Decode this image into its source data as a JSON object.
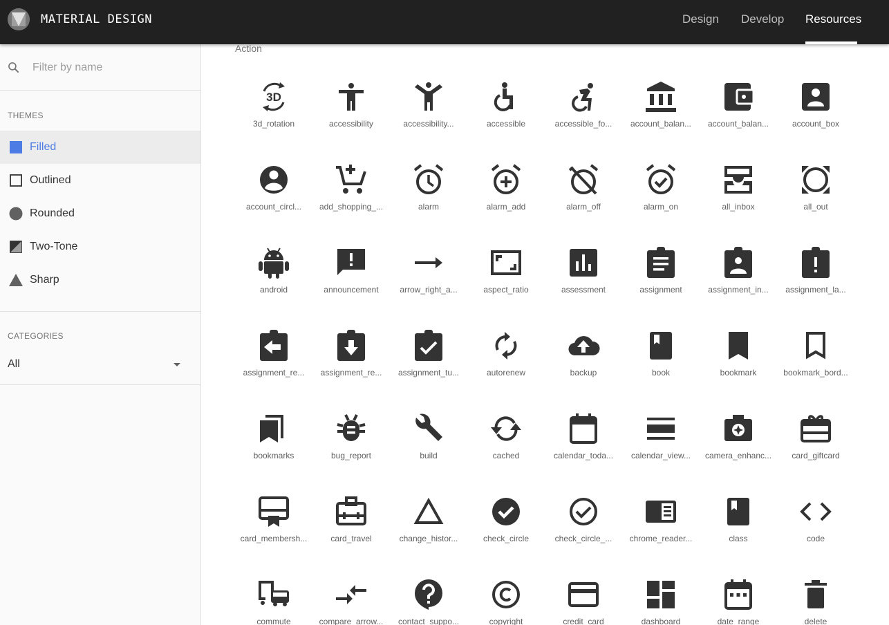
{
  "brand": "MATERIAL DESIGN",
  "nav": [
    {
      "label": "Design",
      "active": false
    },
    {
      "label": "Develop",
      "active": false
    },
    {
      "label": "Resources",
      "active": true
    }
  ],
  "search": {
    "placeholder": "Filter by name",
    "value": ""
  },
  "themes": {
    "title": "THEMES",
    "items": [
      {
        "label": "Filled",
        "icon": "filled-square-icon",
        "active": true
      },
      {
        "label": "Outlined",
        "icon": "outlined-square-icon",
        "active": false
      },
      {
        "label": "Rounded",
        "icon": "rounded-circle-icon",
        "active": false
      },
      {
        "label": "Two-Tone",
        "icon": "two-tone-icon",
        "active": false
      },
      {
        "label": "Sharp",
        "icon": "sharp-triangle-icon",
        "active": false
      }
    ]
  },
  "categories": {
    "title": "CATEGORIES",
    "selected": "All"
  },
  "main": {
    "category": "Action",
    "icons": [
      {
        "label": "3d_rotation",
        "icon": "3d-rotation-icon"
      },
      {
        "label": "accessibility",
        "icon": "accessibility-icon"
      },
      {
        "label": "accessibility...",
        "icon": "accessibility-new-icon"
      },
      {
        "label": "accessible",
        "icon": "accessible-icon"
      },
      {
        "label": "accessible_fo...",
        "icon": "accessible-forward-icon"
      },
      {
        "label": "account_balan...",
        "icon": "account-balance-icon"
      },
      {
        "label": "account_balan...",
        "icon": "account-balance-wallet-icon"
      },
      {
        "label": "account_box",
        "icon": "account-box-icon"
      },
      {
        "label": "account_circl...",
        "icon": "account-circle-icon"
      },
      {
        "label": "add_shopping_...",
        "icon": "add-shopping-cart-icon"
      },
      {
        "label": "alarm",
        "icon": "alarm-icon"
      },
      {
        "label": "alarm_add",
        "icon": "alarm-add-icon"
      },
      {
        "label": "alarm_off",
        "icon": "alarm-off-icon"
      },
      {
        "label": "alarm_on",
        "icon": "alarm-on-icon"
      },
      {
        "label": "all_inbox",
        "icon": "all-inbox-icon"
      },
      {
        "label": "all_out",
        "icon": "all-out-icon"
      },
      {
        "label": "android",
        "icon": "android-icon"
      },
      {
        "label": "announcement",
        "icon": "announcement-icon"
      },
      {
        "label": "arrow_right_a...",
        "icon": "arrow-right-alt-icon"
      },
      {
        "label": "aspect_ratio",
        "icon": "aspect-ratio-icon"
      },
      {
        "label": "assessment",
        "icon": "assessment-icon"
      },
      {
        "label": "assignment",
        "icon": "assignment-icon"
      },
      {
        "label": "assignment_in...",
        "icon": "assignment-ind-icon"
      },
      {
        "label": "assignment_la...",
        "icon": "assignment-late-icon"
      },
      {
        "label": "assignment_re...",
        "icon": "assignment-return-icon"
      },
      {
        "label": "assignment_re...",
        "icon": "assignment-returned-icon"
      },
      {
        "label": "assignment_tu...",
        "icon": "assignment-turned-in-icon"
      },
      {
        "label": "autorenew",
        "icon": "autorenew-icon"
      },
      {
        "label": "backup",
        "icon": "backup-icon"
      },
      {
        "label": "book",
        "icon": "book-icon"
      },
      {
        "label": "bookmark",
        "icon": "bookmark-icon"
      },
      {
        "label": "bookmark_bord...",
        "icon": "bookmark-border-icon"
      },
      {
        "label": "bookmarks",
        "icon": "bookmarks-icon"
      },
      {
        "label": "bug_report",
        "icon": "bug-report-icon"
      },
      {
        "label": "build",
        "icon": "build-icon"
      },
      {
        "label": "cached",
        "icon": "cached-icon"
      },
      {
        "label": "calendar_toda...",
        "icon": "calendar-today-icon"
      },
      {
        "label": "calendar_view...",
        "icon": "calendar-view-day-icon"
      },
      {
        "label": "camera_enhanc...",
        "icon": "camera-enhance-icon"
      },
      {
        "label": "card_giftcard",
        "icon": "card-giftcard-icon"
      },
      {
        "label": "card_membersh...",
        "icon": "card-membership-icon"
      },
      {
        "label": "card_travel",
        "icon": "card-travel-icon"
      },
      {
        "label": "change_histor...",
        "icon": "change-history-icon"
      },
      {
        "label": "check_circle",
        "icon": "check-circle-icon"
      },
      {
        "label": "check_circle_...",
        "icon": "check-circle-outline-icon"
      },
      {
        "label": "chrome_reader...",
        "icon": "chrome-reader-mode-icon"
      },
      {
        "label": "class",
        "icon": "class-icon"
      },
      {
        "label": "code",
        "icon": "code-icon"
      },
      {
        "label": "commute",
        "icon": "commute-icon"
      },
      {
        "label": "compare_arrow...",
        "icon": "compare-arrows-icon"
      },
      {
        "label": "contact_suppo...",
        "icon": "contact-support-icon"
      },
      {
        "label": "copyright",
        "icon": "copyright-icon"
      },
      {
        "label": "credit_card",
        "icon": "credit-card-icon"
      },
      {
        "label": "dashboard",
        "icon": "dashboard-icon"
      },
      {
        "label": "date_range",
        "icon": "date-range-icon"
      },
      {
        "label": "delete",
        "icon": "delete-icon"
      }
    ]
  },
  "colors": {
    "topbar": "#212121",
    "accent": "#4d7ce4",
    "icon": "#333333",
    "sidebar": "#fafafa"
  }
}
